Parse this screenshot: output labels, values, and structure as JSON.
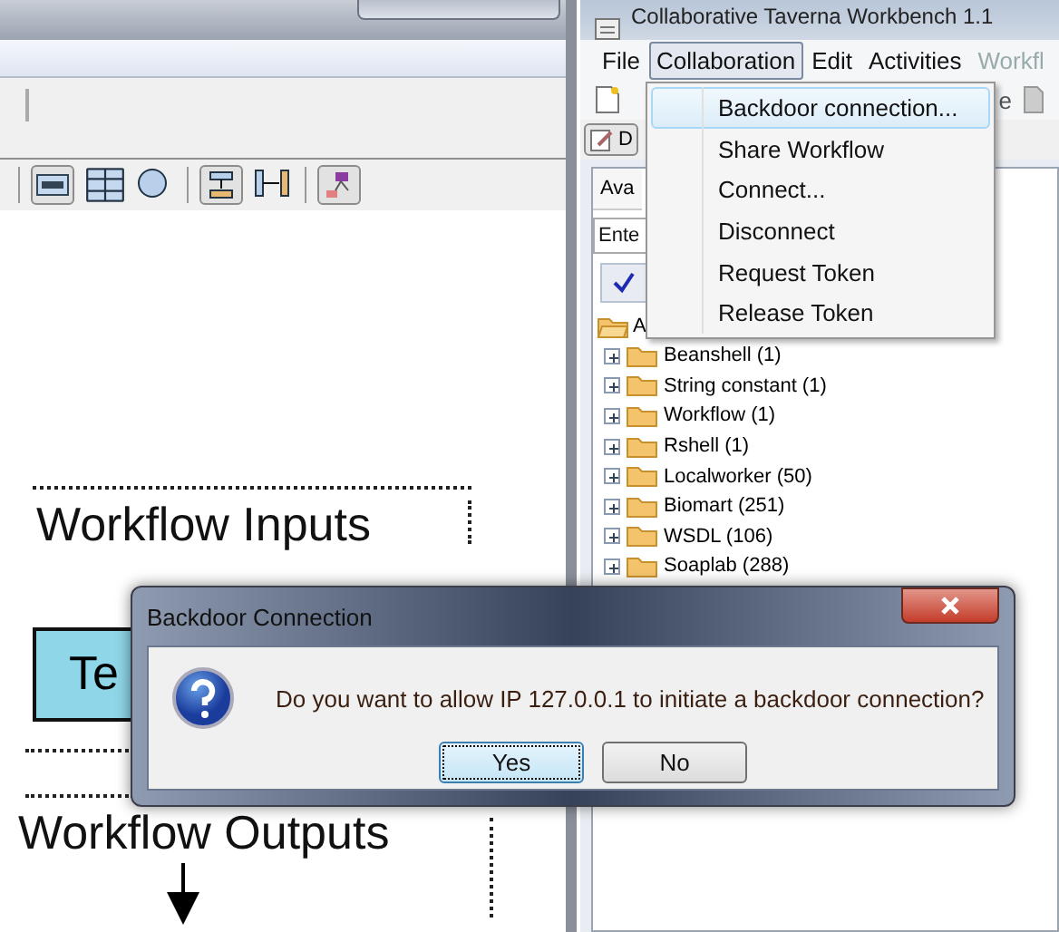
{
  "left_window": {
    "canvas": {
      "inputs_label": "Workflow Inputs",
      "node_label": "Te",
      "outputs_label": "Workflow Outputs"
    }
  },
  "right_window": {
    "title": "Collaborative Taverna Workbench 1.1",
    "menu": [
      {
        "label": "File",
        "selected": false,
        "disabled": false
      },
      {
        "label": "Collaboration",
        "selected": true,
        "disabled": false
      },
      {
        "label": "Edit",
        "selected": false,
        "disabled": false
      },
      {
        "label": "Activities",
        "selected": false,
        "disabled": false
      },
      {
        "label": "Workfl",
        "selected": false,
        "disabled": true
      }
    ],
    "toolbar_text": "e",
    "toolbar_button": "D",
    "tab": "Ava",
    "search": {
      "placeholder": "Ente"
    },
    "tree": {
      "label": "A",
      "expanded": true,
      "children": [
        {
          "label": "Beanshell (1)",
          "expanded": false
        },
        {
          "label": "String constant (1)",
          "expanded": false
        },
        {
          "label": "Workflow (1)",
          "expanded": false
        },
        {
          "label": "Rshell (1)",
          "expanded": false
        },
        {
          "label": "Localworker (50)",
          "expanded": false
        },
        {
          "label": "Biomart (251)",
          "expanded": false
        },
        {
          "label": "WSDL (106)",
          "expanded": false
        },
        {
          "label": "Soaplab (288)",
          "expanded": false
        }
      ]
    },
    "dropdown": [
      {
        "label": "Backdoor connection...",
        "selected": true
      },
      {
        "label": "Share Workflow",
        "selected": false
      },
      {
        "label": "Connect...",
        "selected": false
      },
      {
        "label": "Disconnect",
        "selected": false
      },
      {
        "label": "Request Token",
        "selected": false
      },
      {
        "label": "Release Token",
        "selected": false
      }
    ]
  },
  "dialog": {
    "title": "Backdoor Connection",
    "message": "Do you want to allow IP 127.0.0.1 to initiate a backdoor connection?",
    "buttons": [
      {
        "label": "Yes",
        "focused": true
      },
      {
        "label": "No",
        "focused": false
      }
    ]
  }
}
